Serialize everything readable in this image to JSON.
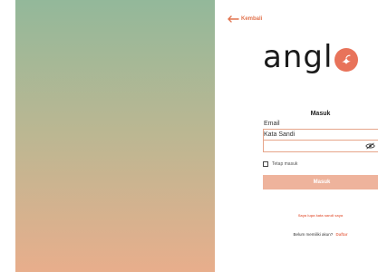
{
  "nav": {
    "back_label": "Kembali"
  },
  "brand": {
    "logo_text": "angl"
  },
  "form": {
    "title": "Masuk",
    "email_label": "Email",
    "email_value": "",
    "password_label": "Kata Sandi",
    "password_value": "",
    "remember_label": "Tetap masuk",
    "remember_checked": false,
    "submit_label": "Masuk"
  },
  "links": {
    "forgot_password": "Saya lupa kata sandi saya",
    "no_account_text": "Belum memiliki akun?",
    "signup_label": "Daftar"
  },
  "icons": {
    "back": "arrow-left-icon",
    "eye": "eye-off-icon",
    "logo": "bird-logo-icon"
  },
  "colors": {
    "accent": "#e8735a",
    "button": "#eeb39c",
    "field_border": "#e6a58a"
  }
}
